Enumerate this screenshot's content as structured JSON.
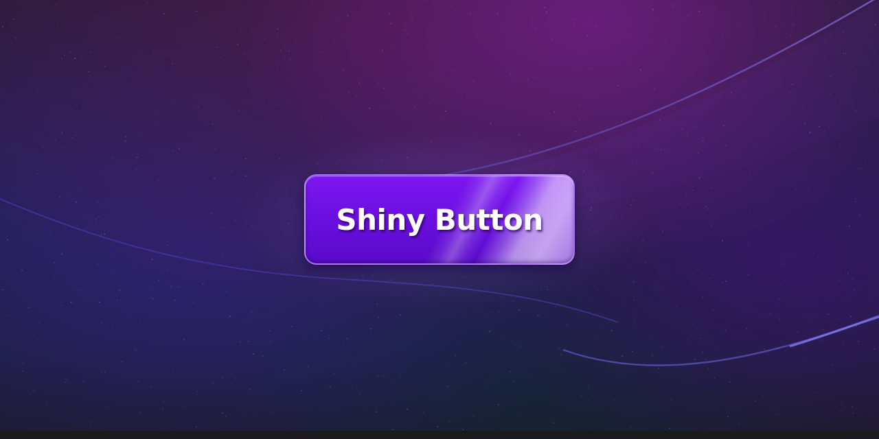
{
  "button": {
    "label": "Shiny Button"
  },
  "colors": {
    "button_top": "#7d16f2",
    "button_bottom": "#5a0ac8",
    "button_border": "#be96ff",
    "background_dark": "#1c1a2e",
    "background_purple": "#781e8c",
    "background_blue": "#2d2378",
    "wave_line": "#6a5ad8"
  }
}
